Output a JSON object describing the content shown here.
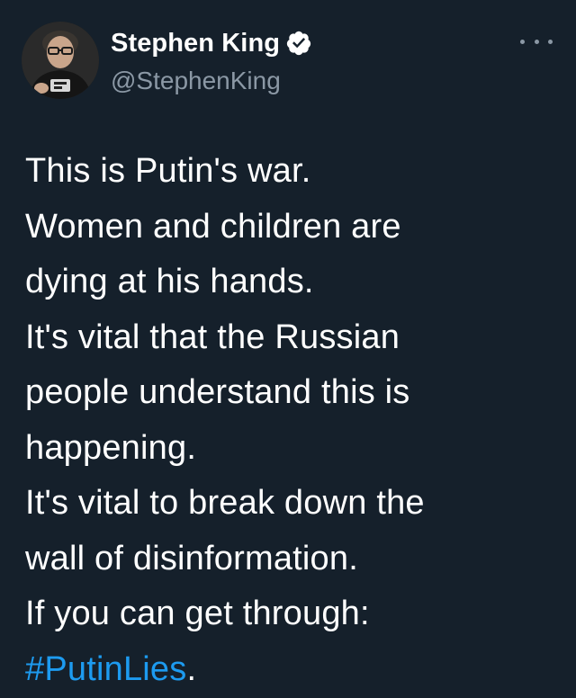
{
  "author": {
    "display_name": "Stephen King",
    "handle": "@StephenKing",
    "verified": true
  },
  "icons": {
    "verified": "verified-badge-icon",
    "more": "more-options-icon"
  },
  "tweet": {
    "lines": [
      "This is Putin's war.",
      "Women and children are",
      "dying at his hands.",
      "It's vital that the Russian",
      "people understand this is",
      "happening.",
      "It's vital to break down the",
      "wall of disinformation.",
      "If you can get through:"
    ],
    "hashtag": "#PutinLies",
    "hashtag_suffix": "."
  },
  "colors": {
    "background": "#15202b",
    "text": "#ffffff",
    "secondary": "#8b98a5",
    "accent": "#1d9bf0"
  }
}
